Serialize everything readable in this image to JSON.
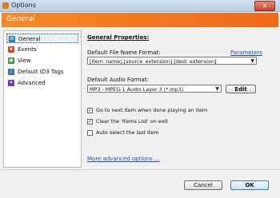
{
  "window": {
    "title": "Options",
    "close_glyph": "✕"
  },
  "banner": {
    "title": "General"
  },
  "sidebar": {
    "items": [
      {
        "label": "General",
        "icon": "general-icon",
        "color": "#2a7ad1"
      },
      {
        "label": "Events",
        "icon": "events-icon",
        "color": "#d14b2a"
      },
      {
        "label": "View",
        "icon": "view-icon",
        "color": "#3a8f3a"
      },
      {
        "label": "Default ID3 Tags",
        "icon": "tags-icon",
        "color": "#3b6fb6"
      },
      {
        "label": "Advanced",
        "icon": "advanced-icon",
        "color": "#6b3bb6"
      }
    ],
    "selected": "General"
  },
  "general": {
    "heading": "General Properties:",
    "file_name_label": "Default File Name Format:",
    "parameters_link": "Parameters",
    "file_name_value": "[item_name].[source_extension].[dest_extension]",
    "audio_format_label": "Default Audio Format:",
    "audio_format_value": "MP3 - MPEG-1 Audio Layer 3 (*.mp3)",
    "edit_button": "Edit",
    "checkboxes": [
      {
        "label": "Go to next item when done playing an item",
        "checked": true
      },
      {
        "label": "Clear the 'Items List' on exit",
        "checked": true
      },
      {
        "label": "Auto select the last item",
        "checked": false
      }
    ],
    "more_link": "More advanced options ..."
  },
  "footer": {
    "cancel_label": "Cancel",
    "ok_label": "OK"
  }
}
